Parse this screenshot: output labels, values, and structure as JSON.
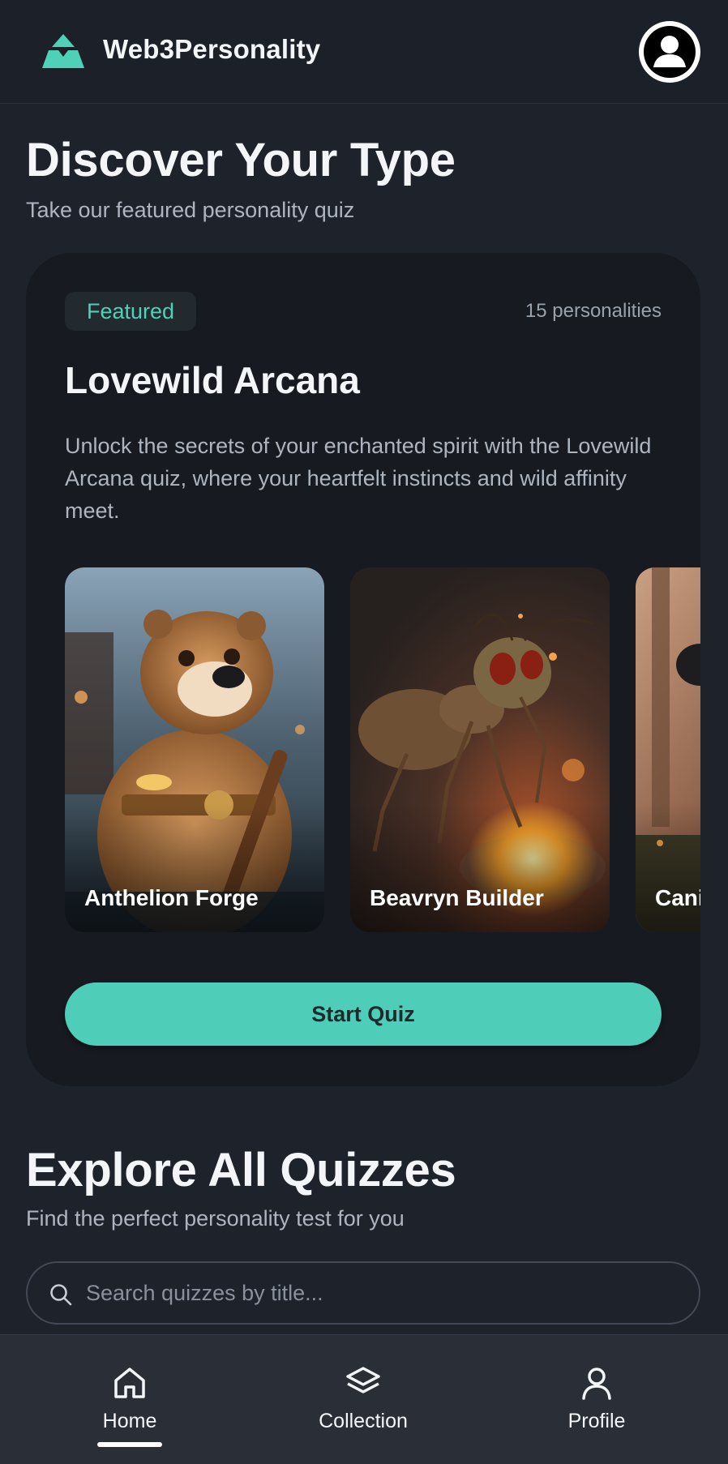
{
  "header": {
    "brand": "Web3Personality",
    "logo_icon": "stacked-pyramid-icon",
    "profile_icon": "user-circle-icon"
  },
  "featured_section": {
    "title": "Discover Your Type",
    "subtitle": "Take our featured personality quiz"
  },
  "featured_quiz": {
    "badge": "Featured",
    "count": "15 personalities",
    "title": "Lovewild Arcana",
    "description": "Unlock the secrets of your enchanted spirit with the Lovewild Arcana quiz, where your heartfelt instincts and wild affinity meet.",
    "personalities": [
      {
        "name": "Anthelion Forge",
        "image": "beaver-with-lantern"
      },
      {
        "name": "Beavryn Builder",
        "image": "ant-over-fire"
      },
      {
        "name": "Cani",
        "image": "canine-in-forest"
      }
    ],
    "cta": "Start Quiz"
  },
  "explore_section": {
    "title": "Explore All Quizzes",
    "subtitle": "Find the perfect personality test for you",
    "search_placeholder": "Search quizzes by title..."
  },
  "bottom_nav": {
    "items": [
      {
        "label": "Home",
        "icon": "home-icon",
        "active": true
      },
      {
        "label": "Collection",
        "icon": "layers-icon",
        "active": false
      },
      {
        "label": "Profile",
        "icon": "person-icon",
        "active": false
      }
    ]
  },
  "colors": {
    "accent": "#4ecdb9",
    "background": "#1e222b",
    "card": "#171a20"
  }
}
